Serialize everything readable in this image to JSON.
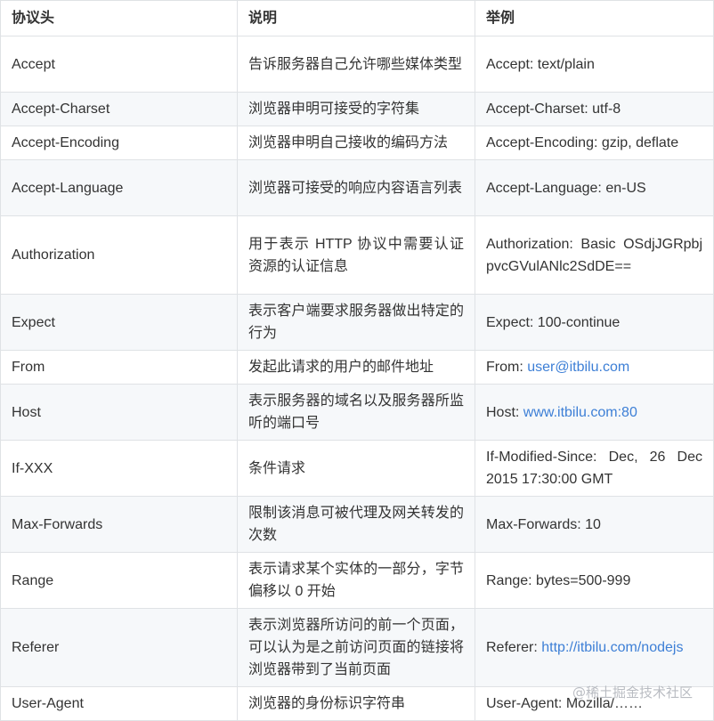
{
  "headers": [
    "协议头",
    "说明",
    "举例"
  ],
  "rows": [
    {
      "name": "Accept",
      "desc": "告诉服务器自己允许哪些媒体类型",
      "ex_pre": "Accept: text/plain",
      "ex_link": ""
    },
    {
      "name": "Accept-Charset",
      "desc": "浏览器申明可接受的字符集",
      "ex_pre": "Accept-Charset: utf-8",
      "ex_link": ""
    },
    {
      "name": "Accept-Encoding",
      "desc": "浏览器申明自己接收的编码方法",
      "ex_pre": "Accept-Encoding: gzip, deflate",
      "ex_link": ""
    },
    {
      "name": "Accept-Language",
      "desc": "浏览器可接受的响应内容语言列表",
      "ex_pre": "Accept-Language: en-US",
      "ex_link": ""
    },
    {
      "name": "Authorization",
      "desc": "用于表示 HTTP 协议中需要认证资源的认证信息",
      "ex_pre": "Authorization: Basic OSdjJGRpbjpvcGVulANlc2SdDE==",
      "ex_link": ""
    },
    {
      "name": "Expect",
      "desc": "表示客户端要求服务器做出特定的行为",
      "ex_pre": "Expect: 100-continue",
      "ex_link": ""
    },
    {
      "name": "From",
      "desc": "发起此请求的用户的邮件地址",
      "ex_pre": "From: ",
      "ex_link": "user@itbilu.com"
    },
    {
      "name": "Host",
      "desc": "表示服务器的域名以及服务器所监听的端口号",
      "ex_pre": "Host: ",
      "ex_link": "www.itbilu.com:80"
    },
    {
      "name": "If-XXX",
      "desc": "条件请求",
      "ex_pre": "If-Modified-Since: Dec, 26 Dec 2015 17:30:00 GMT",
      "ex_link": ""
    },
    {
      "name": "Max-Forwards",
      "desc": "限制该消息可被代理及网关转发的次数",
      "ex_pre": "Max-Forwards: 10",
      "ex_link": ""
    },
    {
      "name": "Range",
      "desc": "表示请求某个实体的一部分，字节偏移以 0 开始",
      "ex_pre": "Range: bytes=500-999",
      "ex_link": ""
    },
    {
      "name": "Referer",
      "desc": "表示浏览器所访问的前一个页面，可以认为是之前访问页面的链接将浏览器带到了当前页面",
      "ex_pre": "Referer: ",
      "ex_link": "http://itbilu.com/nodejs"
    },
    {
      "name": "User-Agent",
      "desc": "浏览器的身份标识字符串",
      "ex_pre": "User-Agent: Mozilla/……",
      "ex_link": ""
    }
  ],
  "watermark": "@稀土掘金技术社区"
}
